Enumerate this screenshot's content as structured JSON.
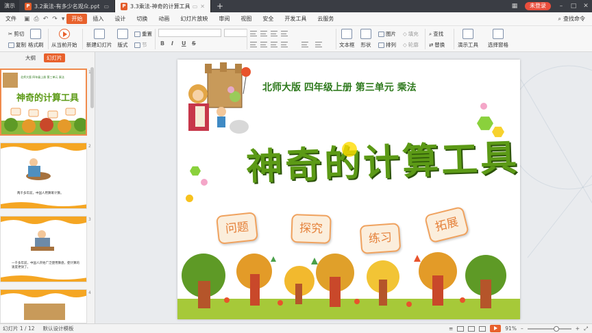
{
  "titlebar": {
    "app_label": "演示",
    "tabs": [
      {
        "title": "3.2乘法-有多少名观众.ppt",
        "active": false
      },
      {
        "title": "3.3乘法-神奇的计算工具.ppt",
        "active": true
      }
    ],
    "new_tab_label": "+",
    "login_label": "未登录"
  },
  "menubar": {
    "file_label": "文件",
    "items": [
      "开始",
      "插入",
      "设计",
      "切换",
      "动画",
      "幻灯片放映",
      "审阅",
      "视图",
      "安全",
      "开发工具",
      "云服务"
    ],
    "active_item": "开始",
    "search_label": "查找命令"
  },
  "ribbon": {
    "cut": "剪切",
    "copy": "复制",
    "format_painter": "格式刷",
    "from_current": "从当前开始",
    "new_slide": "新建幻灯片",
    "layout": "版式",
    "reset": "重置",
    "section": "节",
    "textbox": "文本框",
    "shape": "形状",
    "picture": "图片",
    "arrange": "排列",
    "fill": "填充",
    "outline": "轮廓",
    "find": "查找",
    "replace": "替换",
    "present_tools": "演示工具",
    "select_pane": "选择窗格",
    "bold": "B",
    "italic": "I",
    "underline": "U",
    "strike": "S"
  },
  "panel": {
    "tab_outline": "大纲",
    "tab_slides": "幻灯片",
    "thumbs": [
      {
        "num": "1",
        "caption": ""
      },
      {
        "num": "2",
        "caption": "两千多年前，中国人用算筹计算。"
      },
      {
        "num": "3",
        "caption": "一千多年前，中国人开始广泛使用算盘，使计算的速度更快了。"
      },
      {
        "num": "4",
        "caption": ""
      }
    ],
    "thumb1_sub": "北师大版 四年级上册 第三单元 乘法",
    "thumb1_title": "神奇的计算工具"
  },
  "slide": {
    "subtitle": "北师大版  四年级上册  第三单元  乘法",
    "title": "神奇的计算工具",
    "tags": [
      "问题",
      "探究",
      "练习",
      "拓展"
    ]
  },
  "statusbar": {
    "slide_counter": "幻灯片 1 / 12",
    "template": "默认设计模板",
    "zoom": "91%"
  },
  "colors": {
    "accent": "#e8612c",
    "title_green": "#5c9a16",
    "subtitle_green": "#2f7a1e",
    "tag_orange": "#e5813a"
  }
}
